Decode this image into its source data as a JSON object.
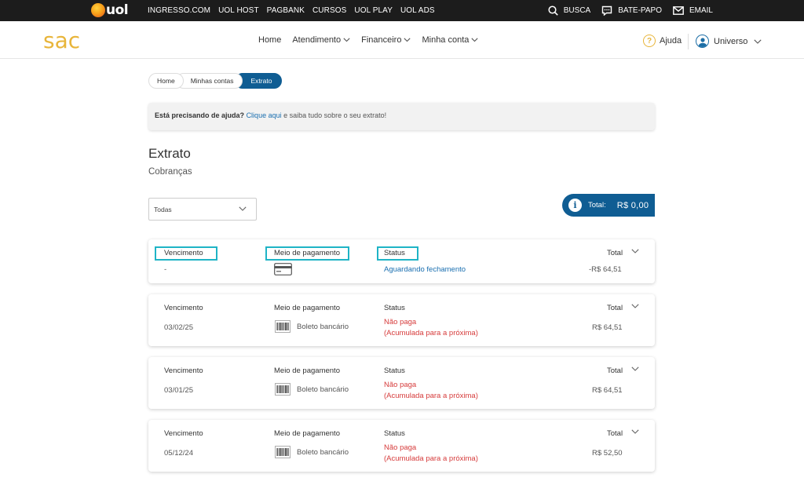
{
  "topbar": {
    "logo_text": "uol",
    "links": [
      "INGRESSO.COM",
      "UOL HOST",
      "PAGBANK",
      "CURSOS",
      "UOL PLAY",
      "UOL ADS"
    ],
    "busca": "BUSCA",
    "bate_papo": "BATE-PAPO",
    "email": "EMAIL"
  },
  "header": {
    "logo": "sac",
    "nav": [
      "Home",
      "Atendimento",
      "Financeiro",
      "Minha conta"
    ],
    "help": "Ajuda",
    "user": "Universo"
  },
  "breadcrumb": [
    "Home",
    "Minhas contas",
    "Extrato"
  ],
  "banner": {
    "bold": "Está precisando de ajuda?",
    "link": "Clique aqui",
    "rest": " e saiba tudo sobre o seu extrato!"
  },
  "page": {
    "title": "Extrato",
    "subtitle": "Cobranças",
    "filter_value": "Todas",
    "total_label": "Total:",
    "total_value": "R$  0,00"
  },
  "columns": {
    "vencimento": "Vencimento",
    "meio": "Meio de pagamento",
    "status": "Status",
    "total": "Total"
  },
  "rows": [
    {
      "vencimento": "-",
      "meio": "",
      "status1": "Aguardando fechamento",
      "status2": "",
      "total": "-R$ 64,51"
    },
    {
      "vencimento": "03/02/25",
      "meio": "Boleto bancário",
      "status1": "Não paga",
      "status2": "(Acumulada para a próxima)",
      "total": "R$ 64,51"
    },
    {
      "vencimento": "03/01/25",
      "meio": "Boleto bancário",
      "status1": "Não paga",
      "status2": "(Acumulada para a próxima)",
      "total": "R$ 64,51"
    },
    {
      "vencimento": "05/12/24",
      "meio": "Boleto bancário",
      "status1": "Não paga",
      "status2": "(Acumulada para a próxima)",
      "total": "R$ 52,50"
    }
  ],
  "colors": {
    "primary_blue": "#0f5d93",
    "link_blue": "#1a6fb0",
    "sac_yellow": "#e8b53a",
    "error_red": "#d63b3b",
    "highlight_cyan": "#1fb4c6"
  }
}
